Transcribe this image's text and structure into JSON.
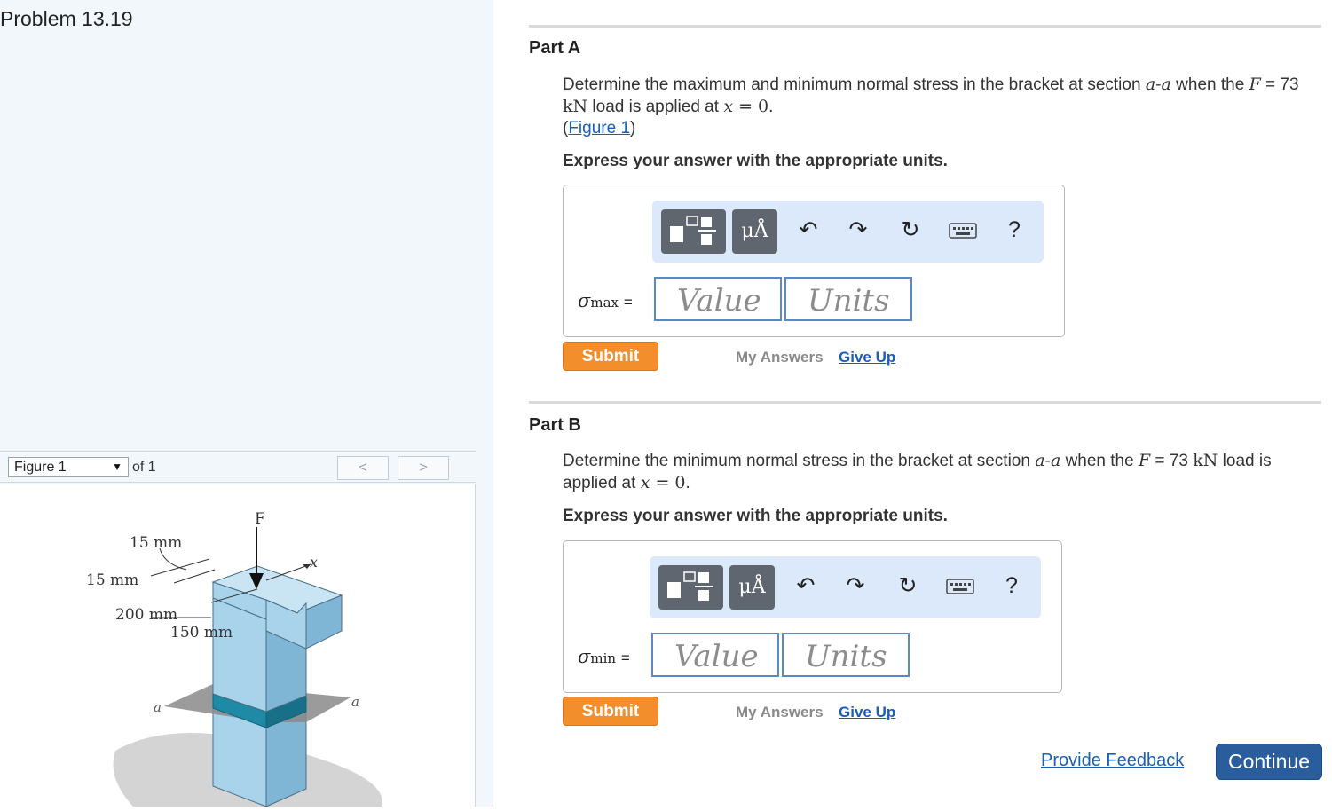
{
  "problem": {
    "title": "Problem 13.19"
  },
  "figure_toolbar": {
    "selected": "Figure 1",
    "caret": "▼",
    "of_label": "of 1",
    "prev_glyph": "<",
    "next_glyph": ">"
  },
  "figure": {
    "labels": {
      "force": "F",
      "x_axis": "x",
      "dim_1": "15 mm",
      "dim_2": "15 mm",
      "dim_3": "200 mm",
      "dim_4": "150 mm",
      "section_left": "a",
      "section_right": "a"
    },
    "colors": {
      "block_light": "#a9d3ea",
      "block_dark": "#7fb6d6",
      "section_band": "#1f8aa6",
      "plane": "#8a8a8a"
    }
  },
  "part_a": {
    "title": "Part A",
    "prompt_1": "Determine the maximum and minimum normal stress in the bracket at section ",
    "section": "a-a",
    "prompt_2": " when the ",
    "force_symbol": "F",
    "prompt_3": " = 73",
    "unit_line_1": "kN",
    "prompt_4": " load is applied at ",
    "var_x": "x",
    "eq_zero": " = 0",
    "period": ".",
    "figure_link_open": "(",
    "figure_link": "Figure 1",
    "figure_link_close": ")",
    "express": "Express your answer with the appropriate units.",
    "sigma_symbol": "σ",
    "sigma_sub": "max",
    "equals": "=",
    "value_placeholder": "Value",
    "units_placeholder": "Units",
    "submit": "Submit",
    "my_answers": "My Answers",
    "give_up": "Give Up"
  },
  "part_b": {
    "title": "Part B",
    "prompt_1": "Determine the minimum normal stress in the bracket at section ",
    "section": "a-a",
    "prompt_2": " when the ",
    "force_symbol": "F",
    "prompt_3": " = 73 ",
    "unit": "kN",
    "prompt_4": " load is",
    "prompt_5": "applied at ",
    "var_x": "x",
    "eq_zero": " = 0",
    "period": ".",
    "express": "Express your answer with the appropriate units.",
    "sigma_symbol": "σ",
    "sigma_sub": "min",
    "equals": "=",
    "value_placeholder": "Value",
    "units_placeholder": "Units",
    "submit": "Submit",
    "my_answers": "My Answers",
    "give_up": "Give Up"
  },
  "toolbar": {
    "units_label": "μÅ",
    "undo_icon": "↶",
    "redo_icon": "↷",
    "reset_icon": "↻",
    "help_label": "?"
  },
  "footer": {
    "provide_feedback": "Provide Feedback",
    "continue": "Continue"
  },
  "colors": {
    "left_panel_bg": "#f2f7fc",
    "submit_orange": "#f28e2b",
    "link_blue": "#1a5fb4",
    "continue_blue": "#2a5d9c",
    "toolbar_bg": "#dbe9fb",
    "input_border": "#5a88c9"
  }
}
